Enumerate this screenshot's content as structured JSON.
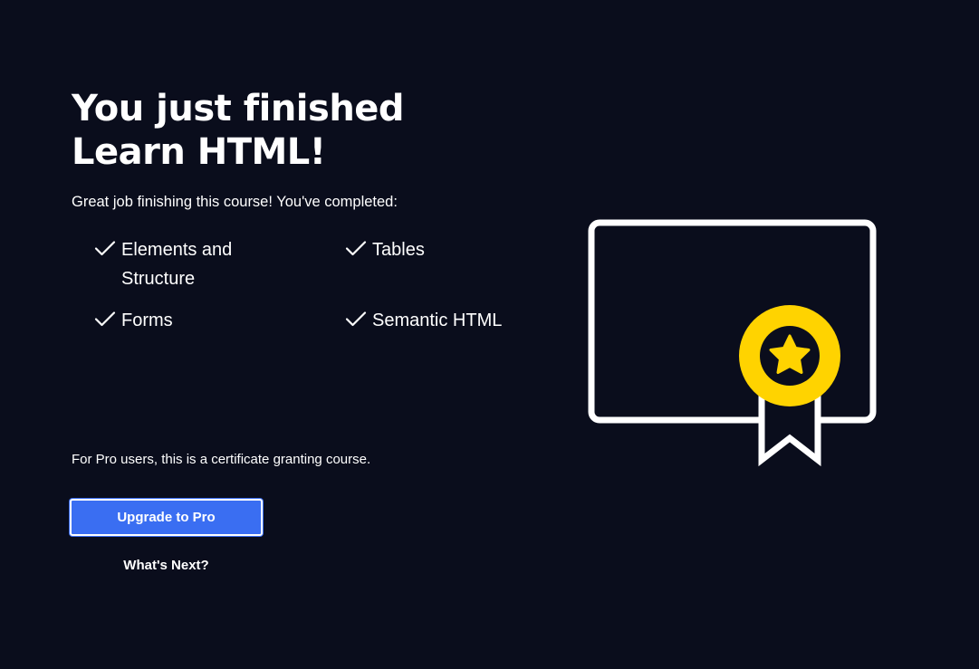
{
  "header": {
    "title_line1": "You just finished",
    "title_line2": "Learn HTML!",
    "subtitle": "Great job finishing this course! You've completed:"
  },
  "completed": {
    "items": [
      {
        "label": "Elements and Structure",
        "icon": "checkmark-icon"
      },
      {
        "label": "Tables",
        "icon": "checkmark-icon"
      },
      {
        "label": "Forms",
        "icon": "checkmark-icon"
      },
      {
        "label": "Semantic HTML",
        "icon": "checkmark-icon"
      }
    ]
  },
  "footer": {
    "pro_note": "For Pro users, this is a certificate granting course.",
    "upgrade_label": "Upgrade to Pro",
    "next_label": "What's Next?"
  },
  "illustration": {
    "icon": "certificate-icon",
    "badge_icon": "star-badge-icon"
  },
  "colors": {
    "background": "#0a0d1c",
    "accent": "#3a6ef2",
    "badge": "#ffd300",
    "text": "#ffffff"
  }
}
